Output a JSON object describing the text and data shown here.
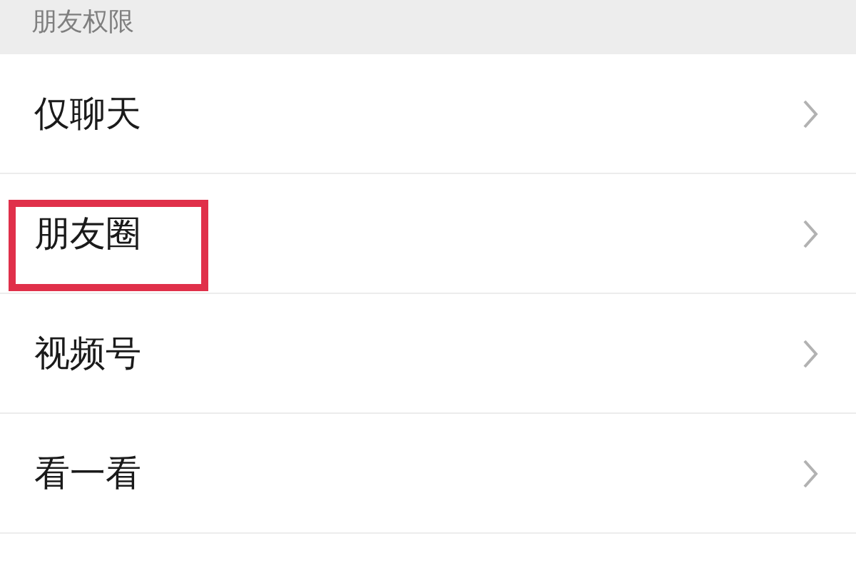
{
  "section_header": "朋友权限",
  "items": [
    {
      "label": "仅聊天",
      "highlighted": false
    },
    {
      "label": "朋友圈",
      "highlighted": true
    },
    {
      "label": "视频号",
      "highlighted": false
    },
    {
      "label": "看一看",
      "highlighted": false
    }
  ]
}
